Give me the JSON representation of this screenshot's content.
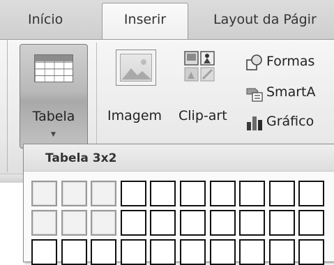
{
  "tabs": [
    {
      "label": "Início"
    },
    {
      "label": "Inserir",
      "active": true
    },
    {
      "label": "Layout da Págir"
    }
  ],
  "ribbon": {
    "tabela": {
      "label": "Tabela",
      "icon": "table-icon",
      "dropdown_icon": "chevron-down-icon"
    },
    "imagem": {
      "label": "Imagem",
      "icon": "picture-icon"
    },
    "clipart": {
      "label": "Clip-art",
      "icon": "clipart-icon"
    },
    "formas": {
      "label": "Formas",
      "icon": "shapes-icon"
    },
    "smartart": {
      "label": "SmartA",
      "icon": "smartart-icon"
    },
    "grafico": {
      "label": "Gráfico",
      "icon": "chart-icon"
    }
  },
  "table_dropdown": {
    "title": "Tabela 3x2",
    "selected_columns": 3,
    "selected_rows": 2,
    "visible_columns": 10,
    "visible_rows": 3
  },
  "colors": {
    "selected_cell_border": "#9a9a9a",
    "cell_border": "#111111",
    "tab_bar": "#d6d6d6"
  }
}
